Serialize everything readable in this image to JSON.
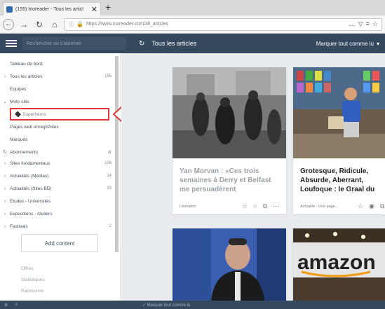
{
  "browser": {
    "tab_title": "(155) Inoreader - Tous les articl",
    "tab_close": "✕",
    "new_tab": "+",
    "url": "https://www.inoreader.com/all_articles"
  },
  "header": {
    "search_placeholder": "Rechercher ou s'abonner",
    "title": "Tous les articles",
    "mark_all": "Marquer tout comme lu"
  },
  "sidebar": {
    "items": [
      {
        "label": "Tableau de bord",
        "count": "",
        "arrow": "",
        "bold": false
      },
      {
        "label": "Tous les articles",
        "count": "155",
        "arrow": "›",
        "bold": false
      },
      {
        "label": "Equipes",
        "count": "",
        "arrow": "",
        "bold": false
      },
      {
        "label": "Mots-clés",
        "count": "",
        "arrow": "⌄",
        "bold": false
      },
      {
        "label": "Superhéros",
        "count": "",
        "arrow": "",
        "bold": false
      },
      {
        "label": "Pages web enregistrées",
        "count": "",
        "arrow": "",
        "bold": false
      },
      {
        "label": "Marqués",
        "count": "",
        "arrow": "",
        "bold": false
      },
      {
        "label": "Abonnements",
        "count": "",
        "arrow": "",
        "bold": false
      },
      {
        "label": "Sites fondamentaux",
        "count": "106",
        "arrow": "›",
        "bold": false
      },
      {
        "label": "Actualités (Médias)",
        "count": "14",
        "arrow": "›",
        "bold": false
      },
      {
        "label": "Actualités (Sites BD)",
        "count": "33",
        "arrow": "›",
        "bold": false
      },
      {
        "label": "Etudes - Universités",
        "count": "",
        "arrow": "›",
        "bold": false
      },
      {
        "label": "Expositions - Ateliers",
        "count": "",
        "arrow": "›",
        "bold": false
      },
      {
        "label": "Festivals",
        "count": "2",
        "arrow": "›",
        "bold": false
      }
    ],
    "add_content": "Add content",
    "footer": [
      "Offres",
      "Statistiques",
      "Raccourcis"
    ]
  },
  "cards": [
    {
      "title": "Yan Morvan : «Ces trois semaines à Derry et Belfast me persuadèrent",
      "meta": "Libération",
      "title_color": "#9aa1a8"
    },
    {
      "title": "Grotesque, Ridicule, Absurde, Aberrant, Loufoque : le Graal du",
      "meta": "Actualité - Une page...",
      "title_color": "#222222"
    }
  ],
  "bottom_bar": {
    "text": "✓ Marquer tout comme lu"
  },
  "colors": {
    "header_bg": "#34495e",
    "highlight": "#e03a3a",
    "main_bg": "#e9ecef"
  }
}
